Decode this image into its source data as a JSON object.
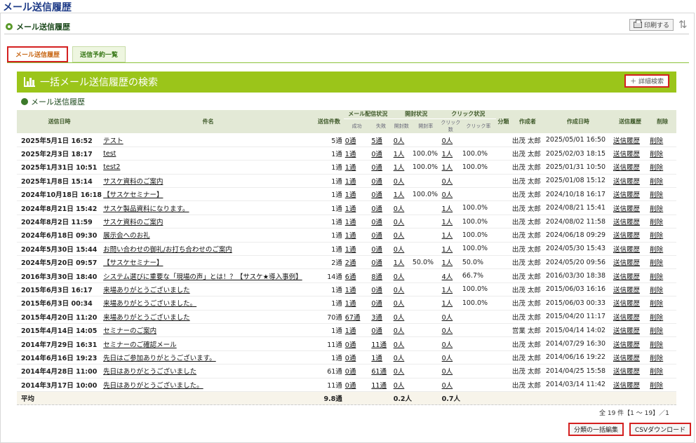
{
  "page_title": "メール送信履歴",
  "section_title": "メール送信履歴",
  "print_label": "印刷する",
  "tabs": [
    {
      "label": "メール送信履歴",
      "active": true
    },
    {
      "label": "送信予約一覧",
      "active": false
    }
  ],
  "banner_title": "一括メール送信履歴の検索",
  "detail_search_label": "＋ 詳細検索",
  "list_title": "メール送信履歴",
  "columns": {
    "sent_date": "送信日時",
    "subject": "件名",
    "count": "送信件数",
    "delivery": "メール配信状況",
    "success": "成功",
    "fail": "失敗",
    "open": "開封状況",
    "open_count": "開封数",
    "open_rate": "開封率",
    "click": "クリック状況",
    "click_count": "クリック数",
    "click_rate": "クリック率",
    "category": "分類",
    "creator": "作成者",
    "created": "作成日時",
    "history": "送信履歴",
    "delete": "削除"
  },
  "rows": [
    {
      "date": "2025年5月1日 16:52",
      "subject": "テスト",
      "count": "5通",
      "success": "0通",
      "fail": "5通",
      "open": "0人",
      "open_rate": "",
      "click": "0人",
      "click_rate": "",
      "creator": "出茂 太郎",
      "created": "2025/05/01 16:50"
    },
    {
      "date": "2025年2月3日 18:17",
      "subject": "test",
      "count": "1通",
      "success": "1通",
      "fail": "0通",
      "open": "1人",
      "open_rate": "100.0%",
      "click": "1人",
      "click_rate": "100.0%",
      "creator": "出茂 太郎",
      "created": "2025/02/03 18:15"
    },
    {
      "date": "2025年1月31日 10:51",
      "subject": "test2",
      "count": "1通",
      "success": "1通",
      "fail": "0通",
      "open": "1人",
      "open_rate": "100.0%",
      "click": "1人",
      "click_rate": "100.0%",
      "creator": "出茂 太郎",
      "created": "2025/01/31 10:50"
    },
    {
      "date": "2025年1月8日 15:14",
      "subject": "サスケ資料のご案内",
      "count": "1通",
      "success": "1通",
      "fail": "0通",
      "open": "0人",
      "open_rate": "",
      "click": "0人",
      "click_rate": "",
      "creator": "出茂 太郎",
      "created": "2025/01/08 15:12"
    },
    {
      "date": "2024年10月18日 16:18",
      "subject": "【サスケセミナー】",
      "count": "1通",
      "success": "1通",
      "fail": "0通",
      "open": "1人",
      "open_rate": "100.0%",
      "click": "0人",
      "click_rate": "",
      "creator": "出茂 太郎",
      "created": "2024/10/18 16:17"
    },
    {
      "date": "2024年8月21日 15:42",
      "subject": "サスケ製品資料になります。",
      "count": "1通",
      "success": "1通",
      "fail": "0通",
      "open": "0人",
      "open_rate": "",
      "click": "1人",
      "click_rate": "100.0%",
      "creator": "出茂 太郎",
      "created": "2024/08/21 15:41"
    },
    {
      "date": "2024年8月2日 11:59",
      "subject": "サスケ資料のご案内",
      "count": "1通",
      "success": "1通",
      "fail": "0通",
      "open": "0人",
      "open_rate": "",
      "click": "1人",
      "click_rate": "100.0%",
      "creator": "出茂 太郎",
      "created": "2024/08/02 11:58"
    },
    {
      "date": "2024年6月18日 09:30",
      "subject": "展示会へのお礼",
      "count": "1通",
      "success": "1通",
      "fail": "0通",
      "open": "0人",
      "open_rate": "",
      "click": "1人",
      "click_rate": "100.0%",
      "creator": "出茂 太郎",
      "created": "2024/06/18 09:29"
    },
    {
      "date": "2024年5月30日 15:44",
      "subject": "お問い合わせの御礼/お打ち合わせのご案内",
      "count": "1通",
      "success": "1通",
      "fail": "0通",
      "open": "0人",
      "open_rate": "",
      "click": "1人",
      "click_rate": "100.0%",
      "creator": "出茂 太郎",
      "created": "2024/05/30 15:43"
    },
    {
      "date": "2024年5月20日 09:57",
      "subject": "【サスケセミナー】",
      "count": "2通",
      "success": "2通",
      "fail": "0通",
      "open": "1人",
      "open_rate": "50.0%",
      "click": "1人",
      "click_rate": "50.0%",
      "creator": "出茂 太郎",
      "created": "2024/05/20 09:56"
    },
    {
      "date": "2016年3月30日 18:40",
      "subject": "システム選びに重要な「現場の声」とは！？【サスケ★導入事例】",
      "count": "14通",
      "success": "6通",
      "fail": "8通",
      "open": "0人",
      "open_rate": "",
      "click": "4人",
      "click_rate": "66.7%",
      "creator": "出茂 太郎",
      "created": "2016/03/30 18:38"
    },
    {
      "date": "2015年6月3日 16:17",
      "subject": "来場ありがとうございました",
      "count": "1通",
      "success": "1通",
      "fail": "0通",
      "open": "0人",
      "open_rate": "",
      "click": "1人",
      "click_rate": "100.0%",
      "creator": "出茂 太郎",
      "created": "2015/06/03 16:16"
    },
    {
      "date": "2015年6月3日 00:34",
      "subject": "来場ありがとうございました。",
      "count": "1通",
      "success": "1通",
      "fail": "0通",
      "open": "0人",
      "open_rate": "",
      "click": "1人",
      "click_rate": "100.0%",
      "creator": "出茂 太郎",
      "created": "2015/06/03 00:33"
    },
    {
      "date": "2015年4月20日 11:20",
      "subject": "来場ありがとうございました",
      "count": "70通",
      "success": "67通",
      "fail": "3通",
      "open": "0人",
      "open_rate": "",
      "click": "0人",
      "click_rate": "",
      "creator": "出茂 太郎",
      "created": "2015/04/20 11:17"
    },
    {
      "date": "2015年4月14日 14:05",
      "subject": "セミナーのご案内",
      "count": "1通",
      "success": "1通",
      "fail": "0通",
      "open": "0人",
      "open_rate": "",
      "click": "0人",
      "click_rate": "",
      "creator": "営業 太郎",
      "created": "2015/04/14 14:02"
    },
    {
      "date": "2014年7月29日 16:31",
      "subject": "セミナーのご確認メール",
      "count": "11通",
      "success": "0通",
      "fail": "11通",
      "open": "0人",
      "open_rate": "",
      "click": "0人",
      "click_rate": "",
      "creator": "出茂 太郎",
      "created": "2014/07/29 16:30"
    },
    {
      "date": "2014年6月16日 19:23",
      "subject": "先日はご参加ありがとうございます。",
      "count": "1通",
      "success": "0通",
      "fail": "1通",
      "open": "0人",
      "open_rate": "",
      "click": "0人",
      "click_rate": "",
      "creator": "出茂 太郎",
      "created": "2014/06/16 19:22"
    },
    {
      "date": "2014年4月28日 11:00",
      "subject": "先日はありがとうございました",
      "count": "61通",
      "success": "0通",
      "fail": "61通",
      "open": "0人",
      "open_rate": "",
      "click": "0人",
      "click_rate": "",
      "creator": "出茂 太郎",
      "created": "2014/04/25 15:58"
    },
    {
      "date": "2014年3月17日 10:00",
      "subject": "先日はありがとうございました。",
      "count": "11通",
      "success": "0通",
      "fail": "11通",
      "open": "0人",
      "open_rate": "",
      "click": "0人",
      "click_rate": "",
      "creator": "出茂 太郎",
      "created": "2014/03/14 11:42"
    }
  ],
  "row_history_label": "送信履歴",
  "row_delete_label": "削除",
  "average": {
    "label": "平均",
    "count": "9.8通",
    "open": "0.2人",
    "click": "0.7人"
  },
  "pager": "全 19 件【1 ～ 19】／1",
  "bulk_category_label": "分類の一括編集",
  "csv_label": "CSVダウンロード"
}
